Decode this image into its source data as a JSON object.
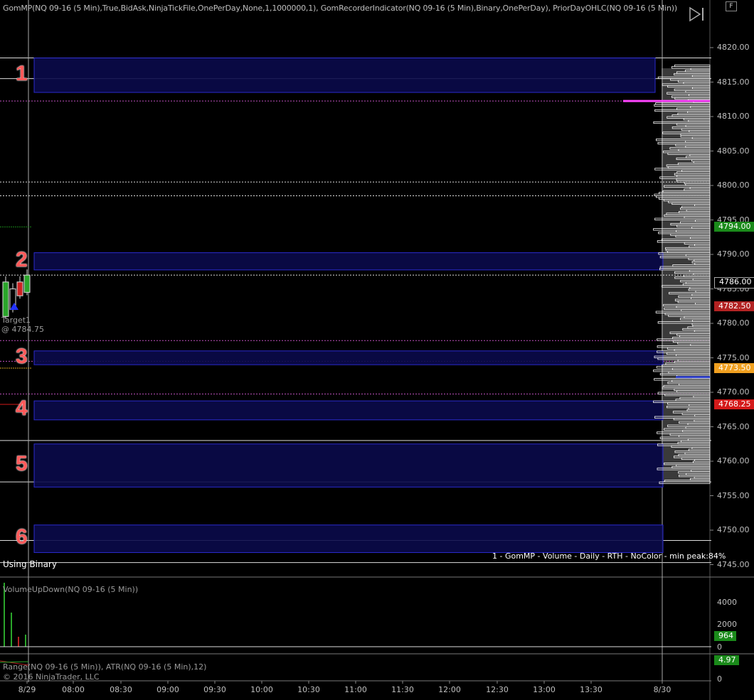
{
  "header": {
    "indicator_line": "GomMP(NQ 09-16 (5 Min),True,BidAsk,NinjaTickFile,OnePerDay,None,1,1000000,1), GomRecorderIndicator(NQ 09-16 (5 Min),Binary,OnePerDay), PriorDayOHLC(NQ 09-16 (5 Min))"
  },
  "toolbar": {
    "f_label": "F"
  },
  "zones": [
    {
      "label": "1",
      "top_price": 4818.5,
      "bottom_price": 4813.5
    },
    {
      "label": "2",
      "top_price": 4790.25,
      "bottom_price": 4787.75
    },
    {
      "label": "3",
      "top_price": 4776.0,
      "bottom_price": 4774.0
    },
    {
      "label": "4",
      "top_price": 4768.75,
      "bottom_price": 4766.0
    },
    {
      "label": "5",
      "top_price": 4762.5,
      "bottom_price": 4756.25
    },
    {
      "label": "6",
      "top_price": 4750.75,
      "bottom_price": 4746.75
    }
  ],
  "price_axis": {
    "ticks": [
      "4820.00",
      "4815.00",
      "4810.00",
      "4805.00",
      "4800.00",
      "4795.00",
      "4790.00",
      "4785.00",
      "4780.00",
      "4775.00",
      "4770.00",
      "4765.00",
      "4760.00",
      "4755.00",
      "4750.00",
      "4745.00"
    ],
    "tick_values": [
      4820,
      4815,
      4810,
      4805,
      4800,
      4795,
      4790,
      4785,
      4780,
      4775,
      4770,
      4765,
      4760,
      4755,
      4750,
      4745
    ],
    "flags": [
      {
        "value": "4794.00",
        "price": 4794.0,
        "color": "#1a8a1a"
      },
      {
        "value": "4786.00",
        "price": 4786.0,
        "color": "#000000"
      },
      {
        "value": "4782.50",
        "price": 4782.5,
        "color": "#b22222"
      },
      {
        "value": "4773.50",
        "price": 4773.5,
        "color": "#f0a020"
      },
      {
        "value": "4768.25",
        "price": 4768.25,
        "color": "#d41a1a"
      }
    ]
  },
  "volume_axis": {
    "ticks": [
      "4000",
      "2000",
      "0"
    ],
    "flag": {
      "value": "964",
      "color": "#1a8a1a"
    }
  },
  "range_axis": {
    "ticks": [
      "0"
    ],
    "flag": {
      "value": "4.97",
      "color": "#1a8a1a"
    }
  },
  "time_axis": {
    "labels": [
      "8/29",
      "08:00",
      "08:30",
      "09:00",
      "09:30",
      "10:00",
      "10:30",
      "11:00",
      "11:30",
      "12:00",
      "12:30",
      "13:00",
      "13:30",
      "8/30"
    ]
  },
  "overlay": {
    "summary": "1 - GomMP - Volume - Daily - RTH - NoColor - min peak:84%",
    "using_binary": "Using Binary",
    "target_label": "Target1",
    "target_price": "@ 4784.75"
  },
  "panels": {
    "volume_title": "VolumeUpDown(NQ 09-16 (5 Min))",
    "range_title": "Range(NQ 09-16 (5 Min)), ATR(NQ 09-16 (5 Min),12)",
    "copyright": "© 2016 NinjaTrader, LLC"
  },
  "colors": {
    "zone_fill": "#0a0a4a",
    "zone_border": "#2a2acc",
    "zone_number": "#ff5a5a",
    "profile_bg": "#3a3a3a",
    "poc_line": "#ff44ff",
    "background": "#000000"
  }
}
